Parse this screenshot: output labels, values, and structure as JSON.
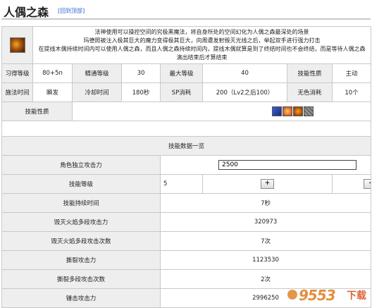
{
  "header": {
    "title": "人偶之森",
    "back_link": "[回到顶部]"
  },
  "skill": {
    "icon": "skill-icon",
    "desc": [
      "法神使用可以操控空间的究极黑魔法，将自身所处的空间幻化为人偶之森最深处的场景",
      "玛德照被注入极其巨大的魔力变得极其巨大，向周遭发射毁灭光线之后，举起双手进行强力打击",
      "在提线木偶持续时间内可以使用人偶之森，而且人偶之森持续时间内，提线木偶就算是到了终结时间也不会终结，而是等待人偶之森演出结束后才算结束"
    ]
  },
  "info_rows": [
    [
      {
        "label": "习得等级",
        "value": "80+5n"
      },
      {
        "label": "精通等级",
        "value": "30"
      },
      {
        "label": "最大等级",
        "value": "40"
      },
      {
        "label": "技能性质",
        "value": "主动"
      }
    ],
    [
      {
        "label": "施法时间",
        "value": "瞬发"
      },
      {
        "label": "冷却时间",
        "value": "180秒"
      },
      {
        "label": "SP消耗",
        "value": "200（Lv2之后100）"
      },
      {
        "label": "无色消耗",
        "value": "10个"
      }
    ]
  ],
  "nature": {
    "label": "技能性质",
    "icons": [
      "blue-arc-icon",
      "flame-burst-icon",
      "fire-orb-icon",
      "gray-grid-icon"
    ]
  },
  "data_title": "技能数据一览",
  "calc": {
    "attack_label": "角色独立攻击力",
    "attack_value": "2500",
    "level_label": "技能等级",
    "level_value": "5",
    "plus": "+",
    "minus": "-"
  },
  "stats": [
    {
      "label": "技能持续时间",
      "value": "7秒"
    },
    {
      "label": "毁灭火焰多段攻击力",
      "value": "320973"
    },
    {
      "label": "毁灭火焰多段攻击次数",
      "value": "7次"
    },
    {
      "label": "撕裂攻击力",
      "value": "1123530"
    },
    {
      "label": "撕裂多段攻击次数",
      "value": "2次"
    },
    {
      "label": "锤击攻击力",
      "value": "2996250"
    }
  ],
  "watermark": {
    "num": "9553",
    "text": "下载"
  }
}
